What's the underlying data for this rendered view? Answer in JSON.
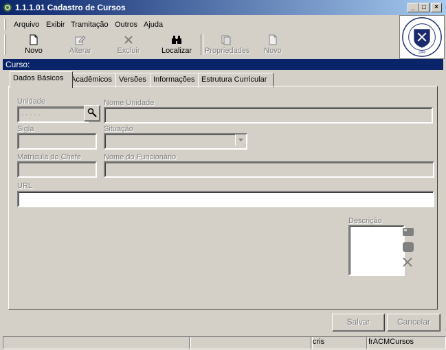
{
  "window": {
    "title": "1.1.1.01 Cadastro de Cursos",
    "min_glyph": "_",
    "max_glyph": "□",
    "close_glyph": "×"
  },
  "menu": [
    "Arquivo",
    "Exibir",
    "Tramitação",
    "Outros",
    "Ajuda"
  ],
  "toolbar": [
    {
      "label": "Novo",
      "icon": "document-icon",
      "enabled": true
    },
    {
      "label": "Alterar",
      "icon": "edit-icon",
      "enabled": false
    },
    {
      "label": "Excluir",
      "icon": "delete-icon",
      "enabled": false
    },
    {
      "label": "Localizar",
      "icon": "binoculars-icon",
      "enabled": true
    },
    {
      "label": "Propriedades",
      "icon": "properties-icon",
      "enabled": false
    },
    {
      "label": "Novo",
      "icon": "document-icon",
      "enabled": false
    }
  ],
  "section_title": "Curso:",
  "tabs": [
    "Dados Básicos",
    "Acadêmicos",
    "Versões",
    "Informações",
    "Estrutura Curricular"
  ],
  "form": {
    "unidade_label": "Unidade",
    "unidade_value": ". . . . .",
    "nome_unidade_label": "Nome Unidade",
    "sigla_label": "Sigla",
    "situacao_label": "Situação",
    "matricula_label": "Matrícula do Chefe",
    "nome_funcionario_label": "Nome do Funcionário",
    "url_label": "URL",
    "descricao_label": "Descrição"
  },
  "buttons": {
    "salvar": "Salvar",
    "cancelar": "Cancelar"
  },
  "status": [
    "",
    "",
    "cris",
    "frACMCursos"
  ]
}
